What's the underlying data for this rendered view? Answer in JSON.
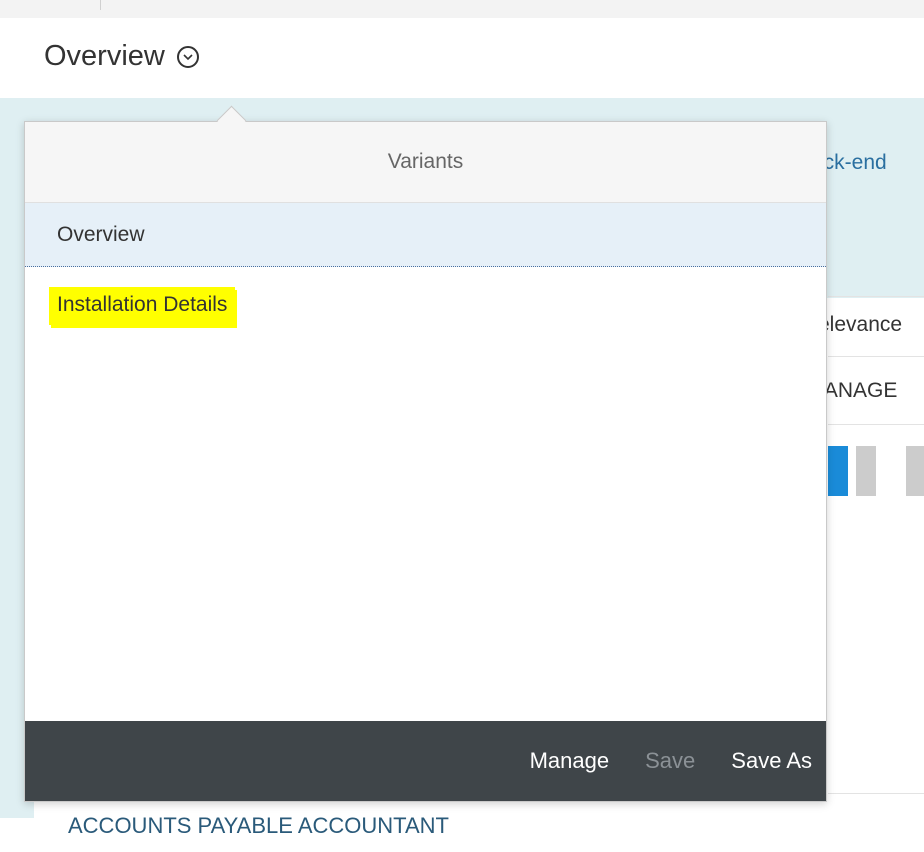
{
  "page": {
    "title": "Overview"
  },
  "background": {
    "link_fragment": "ack-end",
    "relevance_fragment": "elevance",
    "manage_fragment": "IANAGE",
    "footer_item": "ACCOUNTS PAYABLE ACCOUNTANT"
  },
  "variants_popover": {
    "header": "Variants",
    "items": [
      {
        "label": "Overview"
      },
      {
        "label": "Installation Details"
      }
    ],
    "footer": {
      "manage_label": "Manage",
      "save_label": "Save",
      "save_as_label": "Save As"
    }
  },
  "colors": {
    "selected_row": "#e6f0f8",
    "highlight": "#ffff00",
    "footer_bg": "#3f4549",
    "band_bg": "#dfeff2",
    "tile_blue": "#1a8bd8",
    "tile_gray": "#cccccc"
  },
  "icons": {
    "title_dropdown": "chevron-down-circle-icon"
  }
}
